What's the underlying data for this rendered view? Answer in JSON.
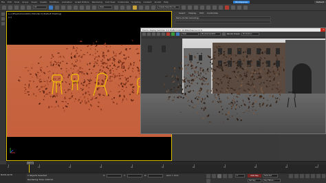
{
  "menubar": {
    "items": [
      "File",
      "Edit",
      "Tools",
      "Group",
      "Views",
      "Create",
      "Modifiers",
      "Animation",
      "Graph Editors",
      "Rendering",
      "Civil View",
      "Customize",
      "Scripting",
      "Content",
      "Arnold",
      "Help"
    ],
    "workspace_active": "Workspaces",
    "workspace_label": "Default"
  },
  "toolbar": {
    "selection_dropdown": "All",
    "view_dropdown": "View",
    "selection_set": "Create Selection Se"
  },
  "viewport": {
    "label": "[+] [PhysCamera001] [Standard] [Default Shading]",
    "frame_label": "[+]"
  },
  "render_window": {
    "title": "Frame, display Gamma: 2.2, RGBA Color 16 Bits/Channel (1:1)",
    "area_to_render": "View",
    "viewport_dropdown": "PhysCamera001",
    "preset_label": "Render Preset:",
    "production": "Production"
  },
  "command_panel": {
    "tabs": [
      "Select",
      "Display",
      "Edit",
      "Customize"
    ],
    "item": "Name (Sorted Ascending)"
  },
  "timeline": {
    "slider_text": "0 / 100",
    "ticks": [
      "0",
      "10",
      "20",
      "30",
      "40",
      "50",
      "60",
      "70",
      "80",
      "90",
      "100"
    ]
  },
  "status": {
    "maxscript": "MAXScript Mi",
    "selection": "1 Objects Selected",
    "prompt": "Rendering Time: 0:00:02",
    "x_label": "X:",
    "y_label": "Y:",
    "z_label": "Z:",
    "grid": "Grid = 10.0",
    "auto_key": "Auto Key",
    "set_key": "Set Key",
    "selected": "Selected",
    "key_filters": "Key Filters...",
    "frame": "0"
  },
  "colors": {
    "accent": "#2c7fd6",
    "viewport_border": "#e0c000",
    "ground": "#c65f3c",
    "chair_wire": "#f2c200",
    "close": "#c42b1c"
  }
}
